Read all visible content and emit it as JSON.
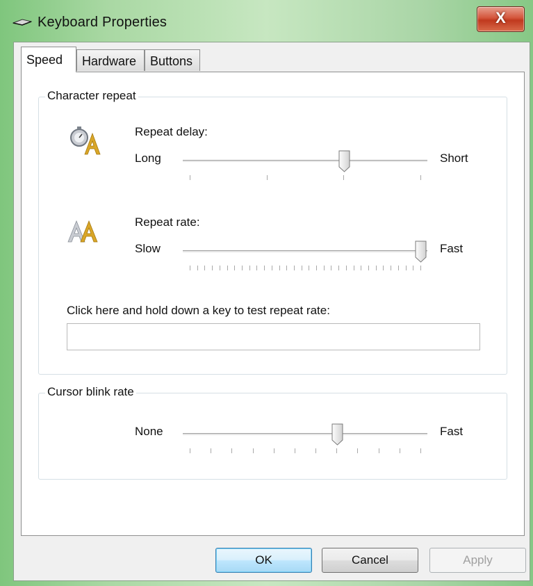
{
  "window": {
    "title": "Keyboard Properties",
    "close_glyph": "X",
    "icon": "keyboard-icon"
  },
  "tabs": [
    {
      "label": "Speed",
      "active": true
    },
    {
      "label": "Hardware",
      "active": false
    },
    {
      "label": "Buttons",
      "active": false
    }
  ],
  "character_repeat": {
    "group_label": "Character repeat",
    "repeat_delay": {
      "label": "Repeat delay:",
      "min_label": "Long",
      "max_label": "Short",
      "icon": "stopwatch-letter-icon",
      "value_fraction": 0.67,
      "tick_count": 4
    },
    "repeat_rate": {
      "label": "Repeat rate:",
      "min_label": "Slow",
      "max_label": "Fast",
      "icon": "double-letter-icon",
      "value_fraction": 1.0,
      "tick_count": 32
    },
    "test_prompt": "Click here and hold down a key to test repeat rate:",
    "test_value": ""
  },
  "cursor_blink": {
    "group_label": "Cursor blink rate",
    "min_label": "None",
    "max_label": "Fast",
    "value_fraction": 0.64,
    "tick_count": 12
  },
  "buttons": {
    "ok": "OK",
    "cancel": "Cancel",
    "apply": "Apply"
  },
  "colors": {
    "frame_green": "#a9d8a3",
    "close_red": "#c0391e",
    "default_button_blue": "#3c7fb1"
  }
}
